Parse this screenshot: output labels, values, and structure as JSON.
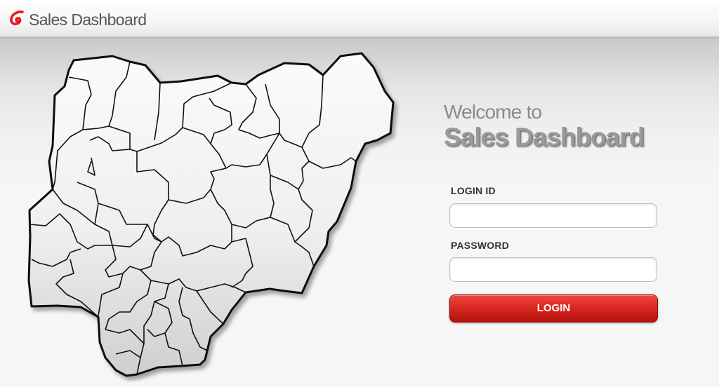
{
  "header": {
    "app_title": "Sales Dashboard",
    "logo_icon": "airtel-swirl-logo"
  },
  "welcome": {
    "line1": "Welcome to",
    "title": "Sales Dashboard"
  },
  "form": {
    "login_id_label": "LOGIN ID",
    "login_id_value": "",
    "password_label": "PASSWORD",
    "password_value": "",
    "login_button": "LOGIN"
  },
  "map": {
    "icon": "nigeria-states-map"
  },
  "colors": {
    "accent": "#d92a22",
    "title_gray": "#9a9a9a",
    "map_stroke": "#111111"
  }
}
